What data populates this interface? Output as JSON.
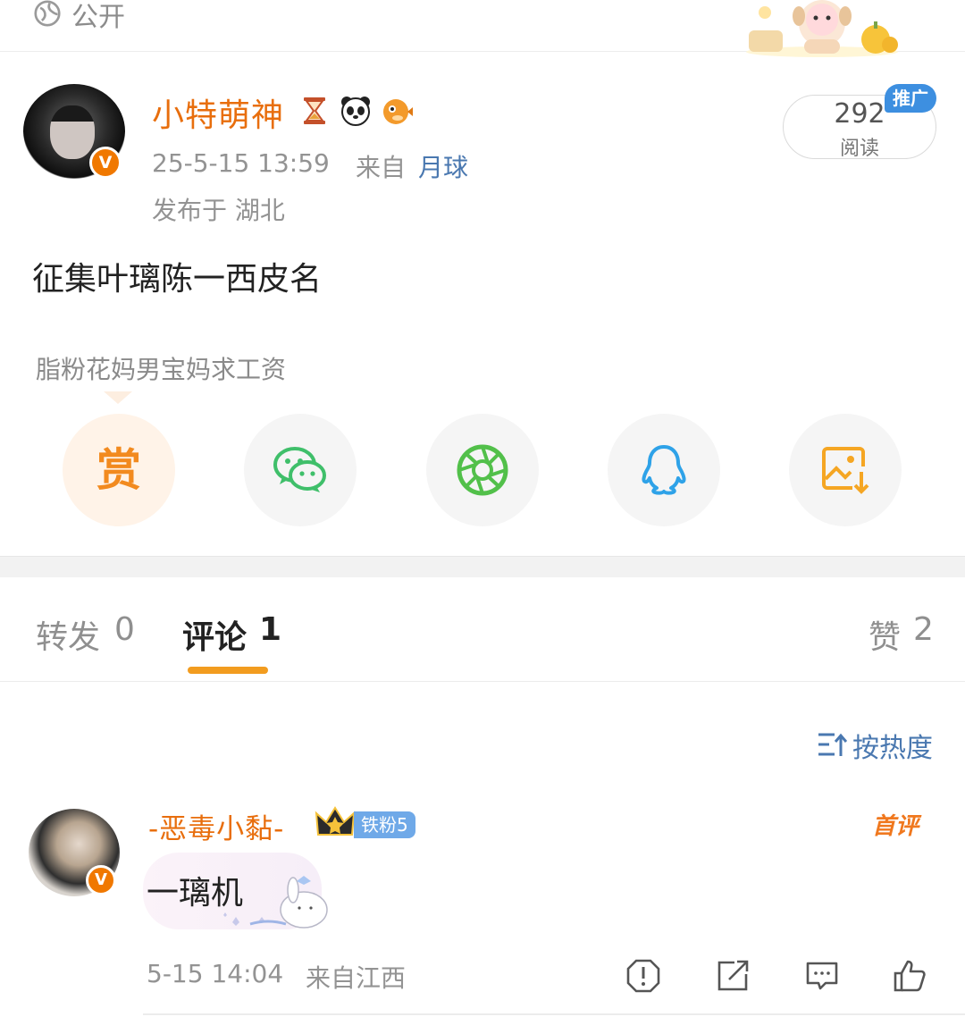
{
  "visibility": {
    "label": "公开",
    "icon": "globe-icon"
  },
  "post": {
    "author": {
      "name": "小特萌神",
      "verified_badge": "V",
      "name_icons": [
        "hourglass-icon",
        "panda-icon",
        "pufferfish-icon"
      ]
    },
    "time": "25-5-15 13:59",
    "source_prefix": "来自",
    "source": "月球",
    "location": "发布于 湖北",
    "read_count": "292",
    "read_label": "阅读",
    "promo_label": "推广",
    "text": "征集叶璃陈一西皮名",
    "tip": "脂粉花妈男宝妈求工资"
  },
  "share_actions": {
    "reward_char": "赏",
    "items": [
      "reward-button",
      "wechat-share-button",
      "moments-share-button",
      "qq-share-button",
      "save-image-button"
    ]
  },
  "tabs": {
    "repost": {
      "label": "转发",
      "count": "0"
    },
    "comment": {
      "label": "评论",
      "count": "1"
    },
    "like": {
      "label": "赞",
      "count": "2"
    }
  },
  "sort": {
    "label": "按热度"
  },
  "comments": [
    {
      "user": "-恶毒小黏-",
      "verified_badge": "V",
      "fan_badge": "铁粉5",
      "first_badge": "首评",
      "text": "一璃机",
      "time": "5-15 14:04",
      "source": "来自江西"
    }
  ],
  "colors": {
    "accent_orange": "#e86e0d",
    "link_blue": "#4a78b0",
    "tab_underline": "#f29c1f"
  }
}
